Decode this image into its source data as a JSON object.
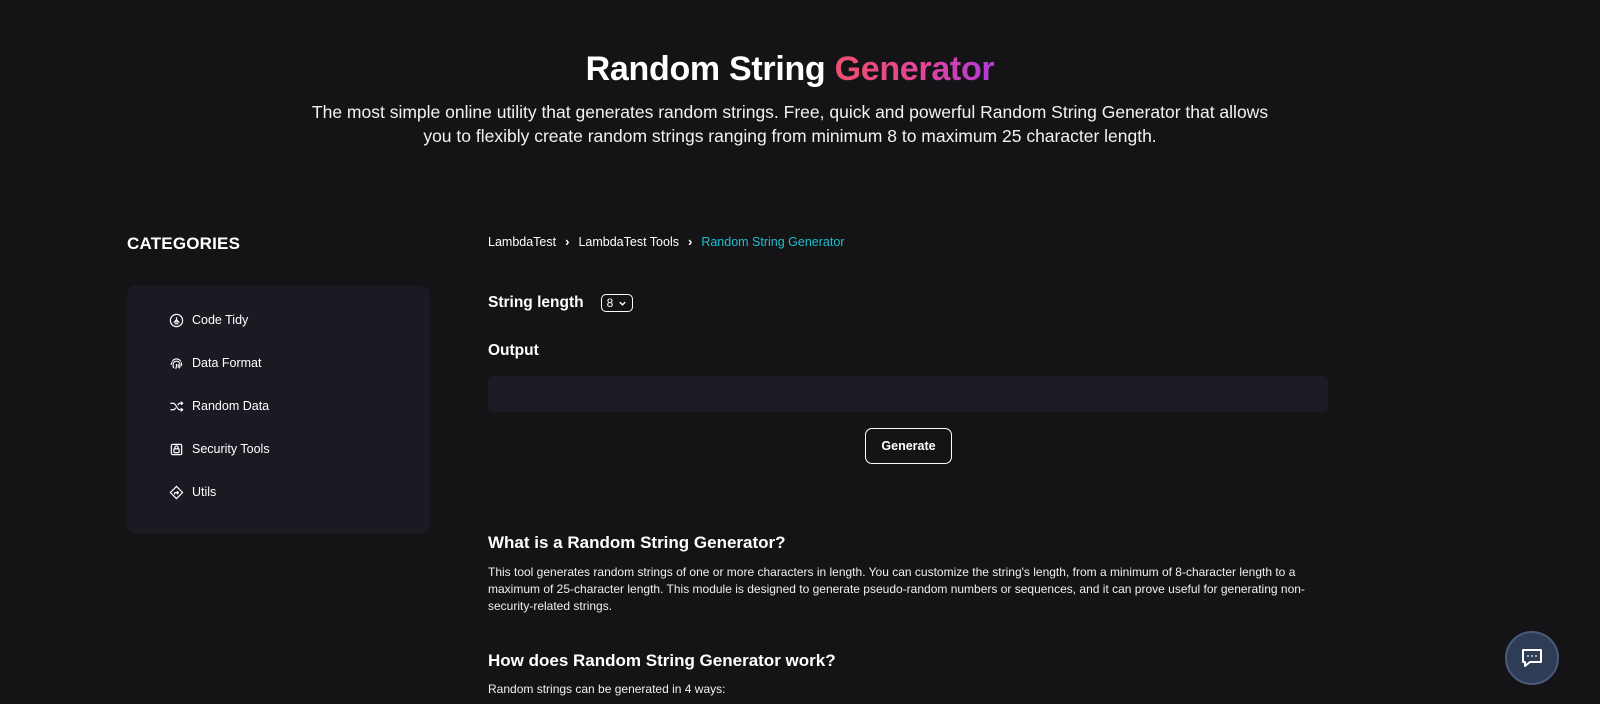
{
  "hero": {
    "title_plain": "Random String",
    "title_accent": "Generator",
    "subtitle": "The most simple online utility that generates random strings. Free, quick and powerful Random String Generator that allows you to flexibly create random strings ranging from minimum 8 to maximum 25 character length."
  },
  "sidebar": {
    "heading": "CATEGORIES",
    "items": [
      {
        "label": "Code Tidy",
        "icon": "code-tidy-icon"
      },
      {
        "label": "Data Format",
        "icon": "fingerprint-icon"
      },
      {
        "label": "Random Data",
        "icon": "shuffle-icon"
      },
      {
        "label": "Security Tools",
        "icon": "lock-icon"
      },
      {
        "label": "Utils",
        "icon": "direction-sign-icon"
      }
    ]
  },
  "breadcrumb": {
    "items": [
      "LambdaTest",
      "LambdaTest Tools",
      "Random String Generator"
    ]
  },
  "form": {
    "length_label": "String length",
    "length_value": "8",
    "output_label": "Output",
    "output_value": "",
    "generate_label": "Generate"
  },
  "content": {
    "what_heading": "What is a Random String Generator?",
    "what_text": "This tool generates random strings of one or more characters in length. You can customize the string's length, from a minimum of 8-character length to a maximum of 25-character length. This module is designed to generate pseudo-random numbers or sequences, and it can prove useful for generating non-security-related strings.",
    "how_heading": "How does Random String Generator work?",
    "how_text": "Random strings can be generated in 4 ways:"
  },
  "colors": {
    "background": "#141416",
    "panel": "#1a1a22",
    "accent_breadcrumb": "#1cbfcf",
    "title_gradient_start": "#ef4f6d",
    "title_gradient_end": "#b13ad8"
  }
}
